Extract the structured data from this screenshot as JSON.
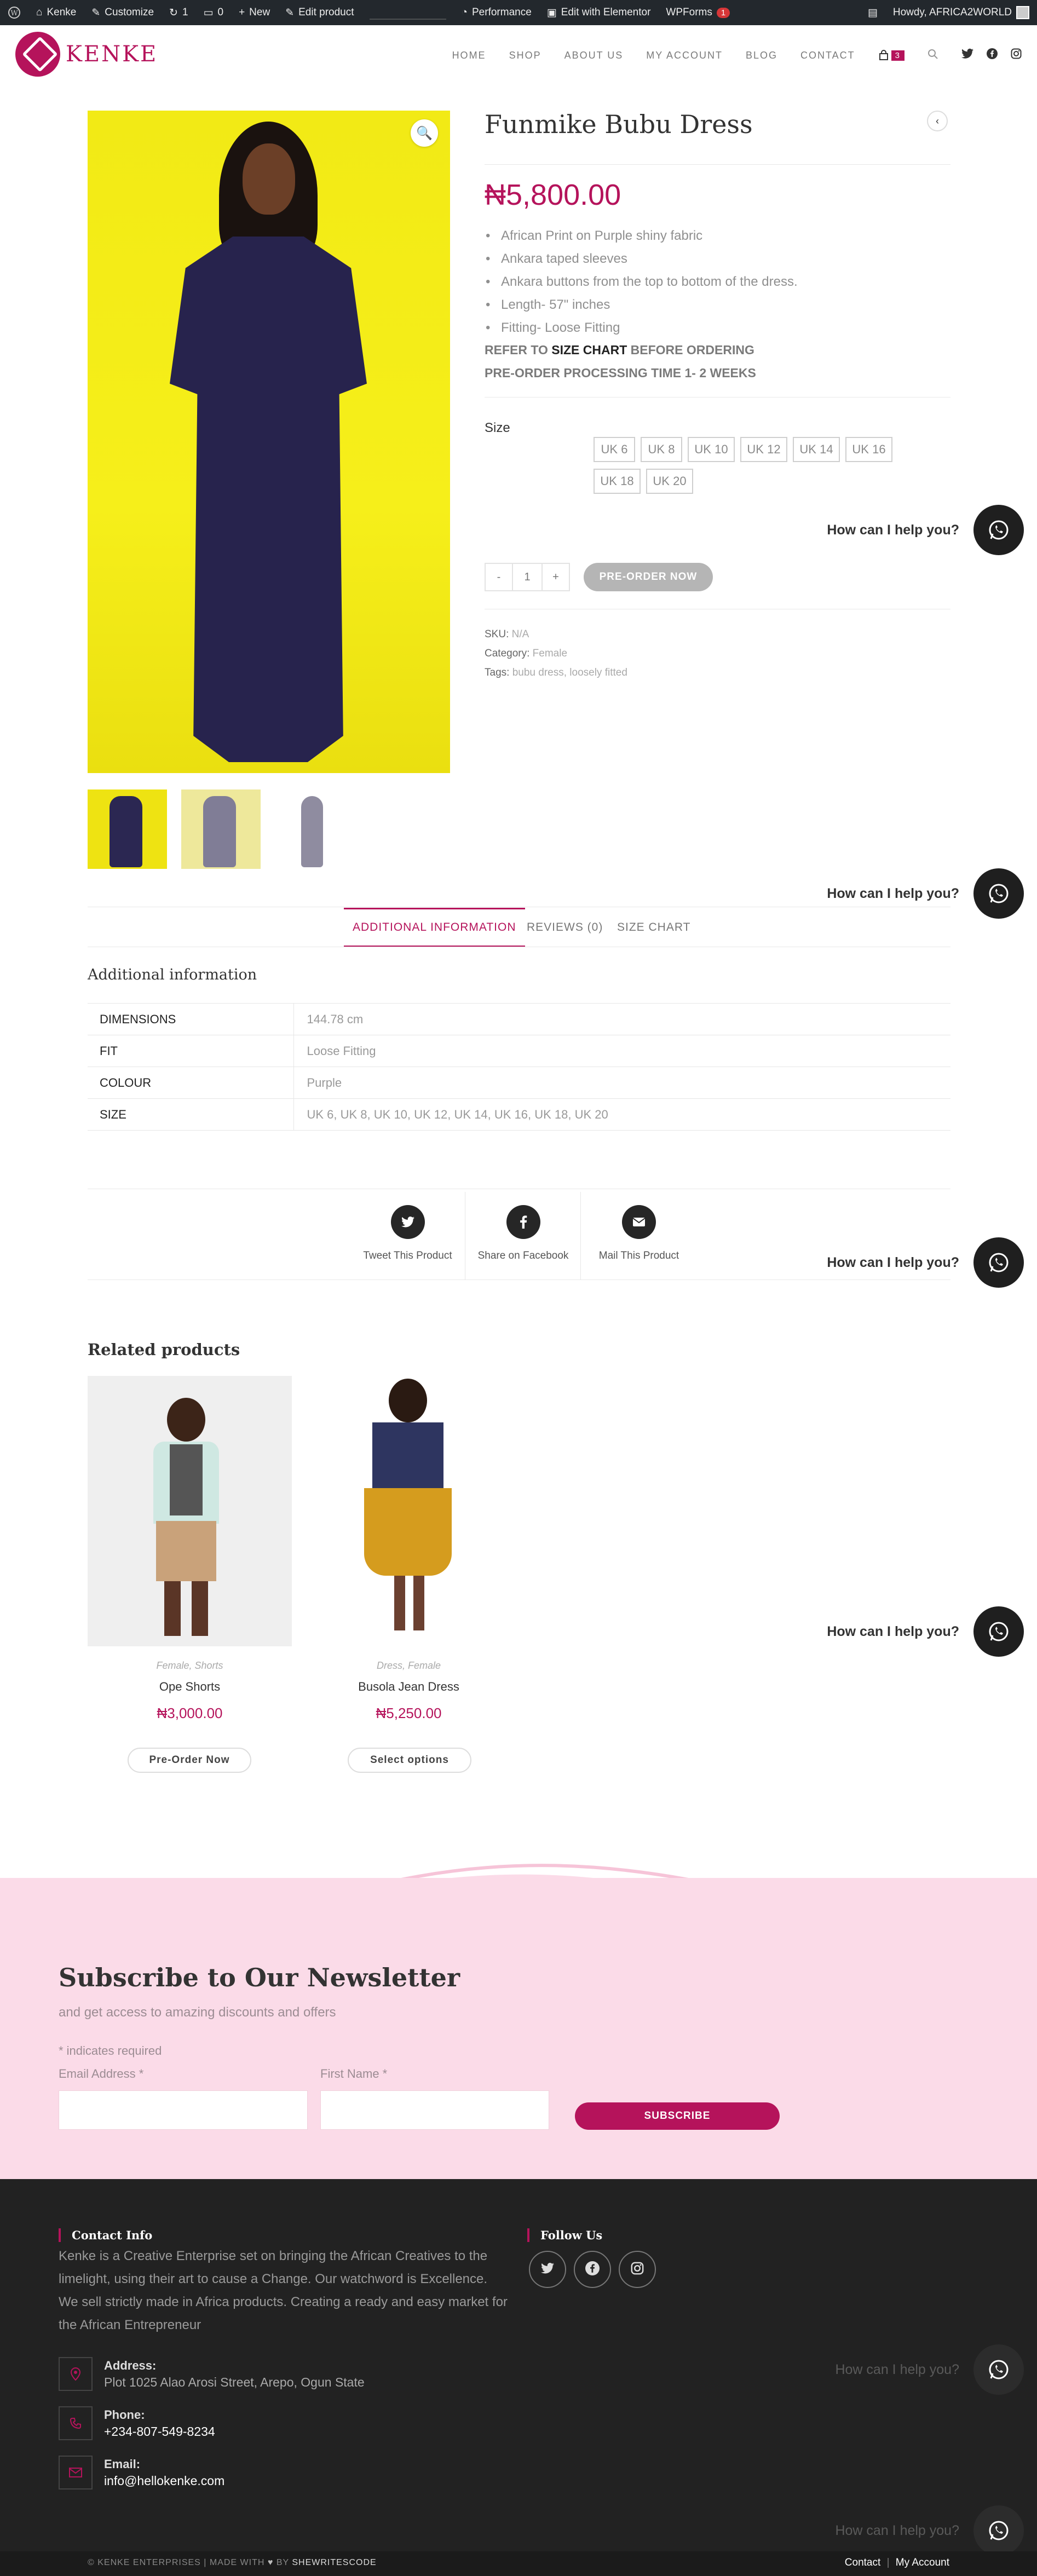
{
  "admin_bar": {
    "site": "Kenke",
    "customize": "Customize",
    "updates": "1",
    "comments": "0",
    "new": "New",
    "edit_product": "Edit product",
    "performance": "Performance",
    "elementor": "Edit with Elementor",
    "wpforms": "WPForms",
    "wpforms_badge": "1",
    "howdy": "Howdy, AFRICA2WORLD"
  },
  "header": {
    "logo": "KENKE",
    "nav": [
      "HOME",
      "SHOP",
      "ABOUT US",
      "MY ACCOUNT",
      "BLOG",
      "CONTACT"
    ],
    "cart_count": "3"
  },
  "product": {
    "title": "Funmike Bubu Dress",
    "price": "₦5,800.00",
    "bullets": [
      "African Print on Purple shiny fabric",
      "Ankara taped sleeves",
      "Ankara buttons from the top to bottom of the dress.",
      "Length- 57\" inches",
      "Fitting- Loose Fitting"
    ],
    "refer_pre": "REFER TO ",
    "refer_link": "SIZE CHART",
    "refer_post": " BEFORE ORDERING",
    "preorder_note": "PRE-ORDER PROCESSING TIME 1- 2 WEEKS",
    "size_label": "Size",
    "sizes": [
      "UK 6",
      "UK 8",
      "UK 10",
      "UK 12",
      "UK 14",
      "UK 16",
      "UK 18",
      "UK 20"
    ],
    "qty_minus": "-",
    "qty_value": "1",
    "qty_plus": "+",
    "preorder_button": "PRE-ORDER NOW",
    "sku_label": "SKU:",
    "sku": "N/A",
    "category_label": "Category:",
    "category": "Female",
    "tags_label": "Tags:",
    "tag1": "bubu dress",
    "tag_sep": ",",
    "tag2": "loosely fitted"
  },
  "help_widget": {
    "text": "How can I help you?"
  },
  "tabs": [
    "ADDITIONAL INFORMATION",
    "REVIEWS (0)",
    "SIZE CHART"
  ],
  "additional": {
    "title": "Additional information",
    "rows": [
      {
        "k": "DIMENSIONS",
        "v": "144.78 cm"
      },
      {
        "k": "FIT",
        "v": "Loose Fitting"
      },
      {
        "k": "COLOUR",
        "v": "Purple"
      },
      {
        "k": "SIZE",
        "v": "UK 6, UK 8, UK 10, UK 12, UK 14, UK 16, UK 18, UK 20"
      }
    ]
  },
  "share": [
    "Tweet This Product",
    "Share on Facebook",
    "Mail This Product"
  ],
  "related": {
    "title": "Related products",
    "items": [
      {
        "cat": "Female, Shorts",
        "name": "Ope Shorts",
        "price": "₦3,000.00",
        "button": "Pre-Order Now"
      },
      {
        "cat": "Dress, Female",
        "name": "Busola Jean Dress",
        "price": "₦5,250.00",
        "button": "Select options"
      }
    ]
  },
  "newsletter": {
    "title": "Subscribe to Our Newsletter",
    "subtitle": "and get access to amazing discounts and offers",
    "required": "* indicates required",
    "email_label": "Email Address *",
    "first_name_label": "First Name *",
    "button": "SUBSCRIBE"
  },
  "footer": {
    "contact_title": "Contact Info",
    "about": "Kenke is a Creative Enterprise set on bringing the African Creatives to the limelight, using their art to cause a Change. Our watchword is Excellence. We sell strictly made in Africa products. Creating a ready and easy market for the African Entrepreneur",
    "follow_title": "Follow Us",
    "address_label": "Address:",
    "address": "Plot 1025 Alao Arosi Street, Arepo, Ogun State",
    "phone_label": "Phone:",
    "phone": "+234-807-549-8234",
    "email_label": "Email:",
    "email": "info@hellokenke.com",
    "copyright_pre": "© KENKE ENTERPRISES | MADE WITH",
    "copyright_by": "BY",
    "copyright_brand": "SHEWRITESCODE",
    "link_contact": "Contact",
    "link_sep": "|",
    "link_account": "My Account"
  },
  "colors": {
    "accent": "#b5135b",
    "admin_bar": "#23282d",
    "newsletter_bg": "#fbdbe8",
    "footer_bg": "#222222"
  }
}
